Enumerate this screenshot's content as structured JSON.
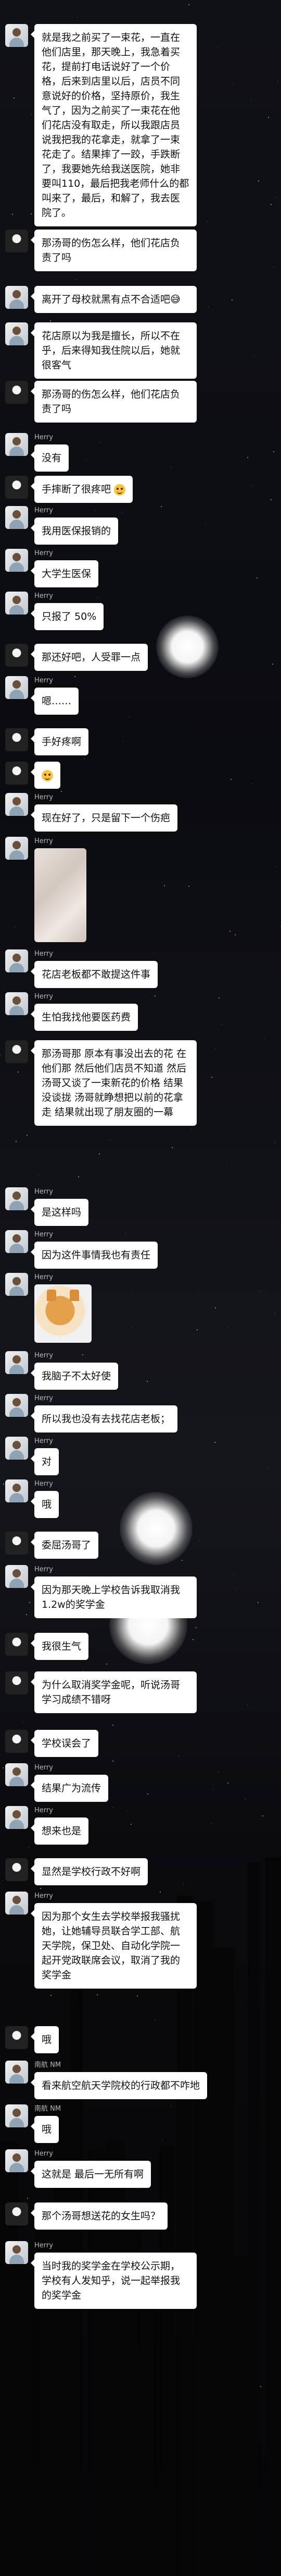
{
  "colors": {
    "background": "#0b0c10",
    "bubble": "#ffffff",
    "text": "#111111",
    "sender_name": "#b9b9b9"
  },
  "messages": [
    {
      "id": 1,
      "avatar": "light",
      "text": "就是我之前买了一束花，一直在他们店里，那天晚上，我急着买花，提前打电话说好了一个价格，后来到店里以后，店员不同意说好的价格，坚持原价，我生气了，因为之前买了一束花在他们花店没有取走，所以我跟店员说我把我的花拿走，就拿了一束花走了。结果摔了一跤，手跌断了，我要她先给我送医院，她非要叫110，最后把我老师什么的都叫来了，最后，和解了，我去医院了。"
    },
    {
      "id": 2,
      "avatar": "dark",
      "text": "那汤哥的伤怎么样，他们花店负责了吗"
    },
    {
      "id": 3,
      "avatar": "light",
      "text": "离开了母校就黑有点不合适吧😅"
    },
    {
      "id": 4,
      "avatar": "light",
      "text": "花店原以为我是擅长，所以不在乎，后来得知我住院以后，她就很客气"
    },
    {
      "id": 5,
      "avatar": "dark",
      "text": "那汤哥的伤怎么样，他们花店负责了吗"
    },
    {
      "id": 6,
      "avatar": "light",
      "sender": "Herry",
      "text": "没有"
    },
    {
      "id": 7,
      "avatar": "dark",
      "text": "手摔断了很疼吧",
      "emoji": true
    },
    {
      "id": 8,
      "avatar": "light",
      "sender": "Herry",
      "text": "我用医保报销的"
    },
    {
      "id": 9,
      "avatar": "light",
      "sender": "Herry",
      "text": "大学生医保"
    },
    {
      "id": 10,
      "avatar": "light",
      "sender": "Herry",
      "text": "只报了 50%"
    },
    {
      "id": 11,
      "avatar": "dark",
      "text": "那还好吧，人受罪一点"
    },
    {
      "id": 12,
      "avatar": "light",
      "sender": "Herry",
      "text": "嗯……"
    },
    {
      "id": 13,
      "avatar": "dark",
      "text": "手好疼啊"
    },
    {
      "id": 14,
      "avatar": "dark",
      "emoji_only": true
    },
    {
      "id": 15,
      "avatar": "light",
      "sender": "Herry",
      "text": "现在好了，只是留下一个伤疤"
    },
    {
      "id": 16,
      "avatar": "light",
      "sender": "Herry",
      "photo": "blurred-photo"
    },
    {
      "id": 17,
      "avatar": "light",
      "sender": "Herry",
      "text": "花店老板都不敢提这件事"
    },
    {
      "id": 18,
      "avatar": "light",
      "sender": "Herry",
      "text": "生怕我找他要医药费"
    },
    {
      "id": 19,
      "avatar": "dark",
      "text": "那汤哥那 原本有事没出去的花 在他们那 然后他们店员不知道 然后汤哥又谈了一束新花的价格 结果没谈拢 汤哥就睁想把以前的花拿走 结果就出现了朋友圈的一幕"
    },
    {
      "id": 20,
      "avatar": "light",
      "sender": "Herry",
      "text": "是这样吗"
    },
    {
      "id": 21,
      "avatar": "light",
      "sender": "Herry",
      "text": "因为这件事情我也有责任"
    },
    {
      "id": 22,
      "avatar": "light",
      "sender": "Herry",
      "photo": "dog-sticker"
    },
    {
      "id": 23,
      "avatar": "light",
      "sender": "Herry",
      "text": "我脑子不太好使"
    },
    {
      "id": 24,
      "avatar": "light",
      "sender": "Herry",
      "text": "所以我也没有去找花店老板；"
    },
    {
      "id": 25,
      "avatar": "light",
      "sender": "Herry",
      "text": "对"
    },
    {
      "id": 26,
      "avatar": "light",
      "sender": "Herry",
      "text": "哦"
    },
    {
      "id": 27,
      "avatar": "dark",
      "text": "委屈汤哥了"
    },
    {
      "id": 28,
      "avatar": "light",
      "sender": "Herry",
      "text": "因为那天晚上学校告诉我取消我1.2w的奖学金"
    },
    {
      "id": 29,
      "avatar": "dark",
      "text": "我很生气"
    },
    {
      "id": 30,
      "avatar": "dark",
      "text": "为什么取消奖学金呢，听说汤哥学习成绩不错呀"
    },
    {
      "id": 31,
      "avatar": "dark",
      "text": "学校误会了"
    },
    {
      "id": 32,
      "avatar": "light",
      "sender": "Herry",
      "text": "结果广为流传"
    },
    {
      "id": 33,
      "avatar": "light",
      "sender": "Herry",
      "text": "想来也是"
    },
    {
      "id": 34,
      "avatar": "dark",
      "text": "显然是学校行政不好啊"
    },
    {
      "id": 35,
      "avatar": "light",
      "sender": "Herry",
      "text": "因为那个女生去学校举报我骚扰她，让她辅导员联合学工部、航天学院，保卫处、自动化学院一起开党政联席会议，取消了我的奖学金"
    },
    {
      "id": 36,
      "avatar": "dark",
      "text": "哦"
    },
    {
      "id": 37,
      "avatar": "light",
      "sender": "南航 NM",
      "text": "看来航空航天学院校的行政都不咋地"
    },
    {
      "id": 38,
      "avatar": "light",
      "sender": "南航 NM",
      "text": "哦"
    },
    {
      "id": 39,
      "avatar": "light",
      "sender": "Herry",
      "text": "这就是 最后一无所有啊"
    },
    {
      "id": 40,
      "avatar": "dark",
      "text": "那个汤哥想送花的女生吗？"
    },
    {
      "id": 41,
      "avatar": "light",
      "sender": "Herry",
      "text": "当时我的奖学金在学校公示期，学校有人发知乎，说一起举报我的奖学金"
    }
  ]
}
